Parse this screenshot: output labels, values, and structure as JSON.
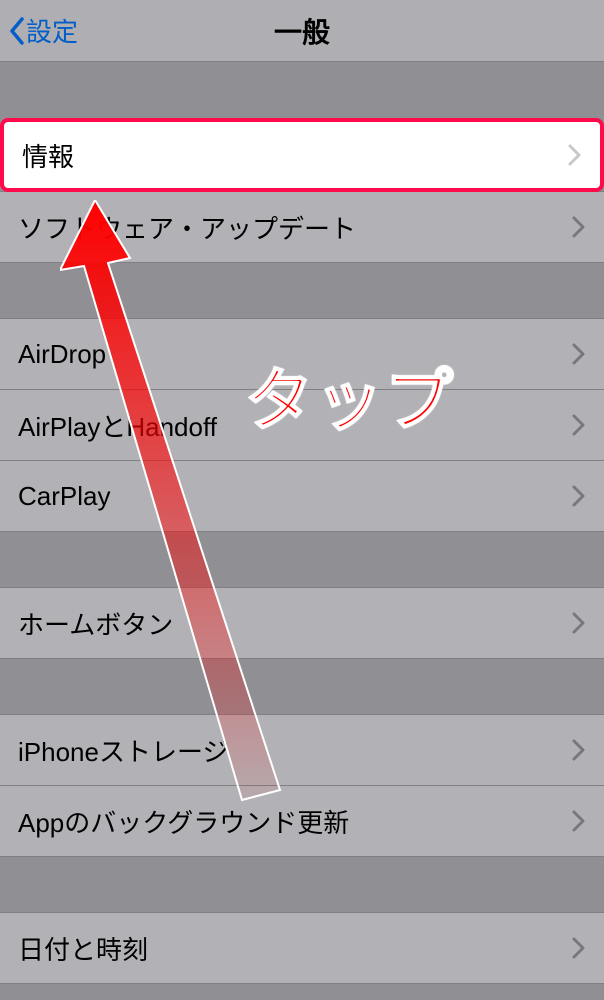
{
  "nav": {
    "back_label": "設定",
    "title": "一般"
  },
  "groups": [
    {
      "rows": [
        {
          "label": "情報",
          "highlighted": true
        },
        {
          "label": "ソフトウェア・アップデート"
        }
      ]
    },
    {
      "rows": [
        {
          "label": "AirDrop"
        },
        {
          "label": "AirPlayとHandoff"
        },
        {
          "label": "CarPlay"
        }
      ]
    },
    {
      "rows": [
        {
          "label": "ホームボタン"
        }
      ]
    },
    {
      "rows": [
        {
          "label": "iPhoneストレージ"
        },
        {
          "label": "Appのバックグラウンド更新"
        }
      ]
    },
    {
      "rows": [
        {
          "label": "日付と時刻"
        }
      ]
    }
  ],
  "annotation": {
    "text": "タップ"
  }
}
